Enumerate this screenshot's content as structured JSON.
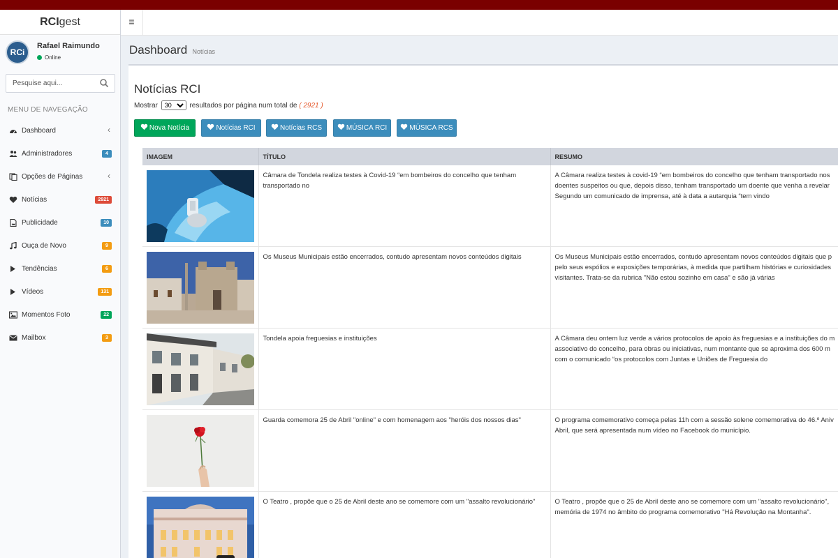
{
  "brand": {
    "bold": "RCI",
    "rest": "gest"
  },
  "user": {
    "avatar_text": "RCi",
    "name": "Rafael Raimundo",
    "status": "Online"
  },
  "search": {
    "placeholder": "Pesquise aqui..."
  },
  "nav_header": "MENU DE NAVEGAÇÃO",
  "nav": [
    {
      "label": "Dashboard",
      "badge": "",
      "badge_color": "",
      "icon": "dashboard-icon",
      "chevron": true
    },
    {
      "label": "Administradores",
      "badge": "4",
      "badge_color": "#3c8dbc",
      "icon": "users-icon",
      "chevron": false
    },
    {
      "label": "Opções de Páginas",
      "badge": "",
      "badge_color": "",
      "icon": "pages-icon",
      "chevron": true
    },
    {
      "label": "Notícias",
      "badge": "2921",
      "badge_color": "#dd4b39",
      "icon": "heart-icon",
      "chevron": false
    },
    {
      "label": "Publicidade",
      "badge": "10",
      "badge_color": "#3c8dbc",
      "icon": "image-file-icon",
      "chevron": false
    },
    {
      "label": "Ouça de Novo",
      "badge": "9",
      "badge_color": "#f39c12",
      "icon": "music-icon",
      "chevron": false
    },
    {
      "label": "Tendências",
      "badge": "6",
      "badge_color": "#f39c12",
      "icon": "play-icon",
      "chevron": false
    },
    {
      "label": "Vídeos",
      "badge": "131",
      "badge_color": "#f39c12",
      "icon": "play-icon",
      "chevron": false
    },
    {
      "label": "Momentos Foto",
      "badge": "22",
      "badge_color": "#00a65a",
      "icon": "picture-icon",
      "chevron": false
    },
    {
      "label": "Mailbox",
      "badge": "3",
      "badge_color": "#f39c12",
      "icon": "envelope-icon",
      "chevron": false
    }
  ],
  "page": {
    "title": "Dashboard",
    "subtitle": "Notícias"
  },
  "box": {
    "title": "Notícias RCI",
    "show_label": "Mostrar",
    "per_page": "30",
    "per_page_suffix": "resultados por página num total de",
    "total": "( 2921 )"
  },
  "buttons": [
    {
      "label": "Nova Notícia",
      "style": "green"
    },
    {
      "label": "Notícias RCI",
      "style": "blue"
    },
    {
      "label": "Notícias RCS",
      "style": "blue"
    },
    {
      "label": "MÚSICA RCI",
      "style": "blue"
    },
    {
      "label": "MÚSICA RCS",
      "style": "blue"
    }
  ],
  "table": {
    "headers": [
      "IMAGEM",
      "TÍTULO",
      "RESUMO"
    ],
    "rows": [
      {
        "image": "covid-test-photo",
        "title": "Câmara de Tondela realiza testes à Covid-19 “em bombeiros do concelho que tenham transportado no",
        "summary": [
          "A Câmara realiza testes à covid-19 “em bombeiros do concelho que tenham transportado nos",
          "doentes suspeitos ou que, depois disso, tenham transportado um doente que venha a revelar",
          "Segundo um comunicado de imprensa, até à data a autarquia “tem vindo"
        ]
      },
      {
        "image": "museum-square-photo",
        "title": "Os Museus Municipais estão encerrados, contudo apresentam novos conteúdos digitais",
        "summary": [
          "Os Museus Municipais estão encerrados, contudo apresentam novos conteúdos digitais que p",
          "pelo seus espólios e exposições temporárias, à medida que partilham histórias e curiosidades",
          "visitantes. Trata-se da rubrica \"Não estou sozinho em casa\" e são já várias"
        ]
      },
      {
        "image": "town-hall-photo",
        "title": "Tondela apoia freguesias e instituições",
        "summary": [
          "A Câmara deu ontem luz verde a vários protocolos de apoio às freguesias e a instituições do m",
          "associativo do concelho, para obras ou iniciativas, num montante que se aproxima dos 600 m",
          "com o comunicado “os protocolos com Juntas e Uniões de Freguesia do"
        ]
      },
      {
        "image": "carnation-photo",
        "title": "Guarda comemora 25 de Abril \"online\" e com homenagem aos \"heróis dos nossos dias\"",
        "summary": [
          "O programa comemorativo começa pelas 11h com a sessão solene comemorativa do 46.º Aniv",
          "Abril, que será apresentada num vídeo no Facebook do município."
        ]
      },
      {
        "image": "theatre-photo",
        "title": "O Teatro , propõe que o 25 de Abril deste ano se comemore com um \"assalto revolucionário\"",
        "summary": [
          "O Teatro , propõe que o 25 de Abril deste ano se comemore com um \"assalto revolucionário\",",
          "memória de 1974 no âmbito do programa comemorativo \"Há Revolução na Montanha\"."
        ]
      }
    ]
  }
}
